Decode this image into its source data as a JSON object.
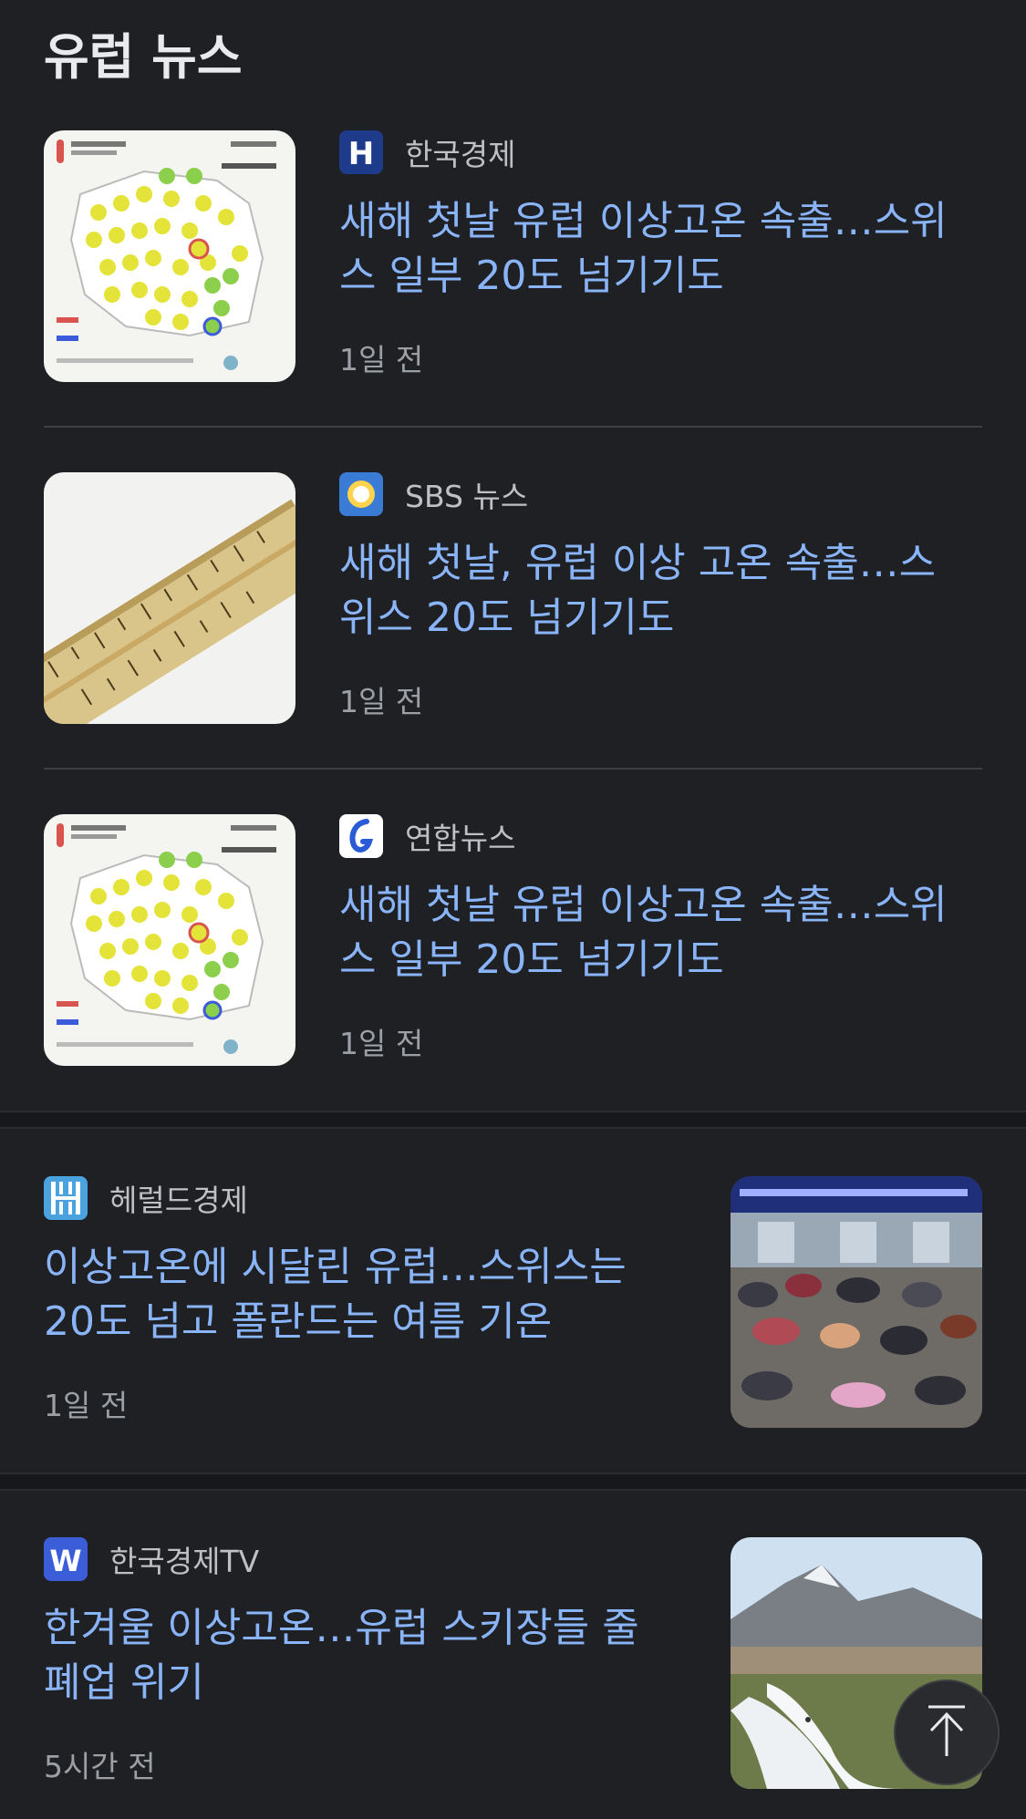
{
  "section": {
    "title": "유럽 뉴스"
  },
  "stories": [
    {
      "source": "한국경제",
      "headline_l1": "새해 첫날 유럽 이상고온 속출…스위",
      "headline_l2": "스 일부 20도 넘기기도",
      "time": "1일 전",
      "icon": "hankyung-logo-icon",
      "thumb": "poland-temperature-map-image"
    },
    {
      "source": "SBS 뉴스",
      "headline_l1": "새해 첫날, 유럽 이상 고온 속출…스",
      "headline_l2": "위스 20도 넘기기도",
      "time": "1일 전",
      "icon": "sbs-logo-icon",
      "thumb": "thermometer-image"
    },
    {
      "source": "연합뉴스",
      "headline_l1": "새해 첫날 유럽 이상고온 속출…스위",
      "headline_l2": "스 일부 20도 넘기기도",
      "time": "1일 전",
      "icon": "yonhap-logo-icon",
      "thumb": "poland-temperature-map-image"
    },
    {
      "source": "헤럴드경제",
      "headline_l1": "이상고온에 시달린 유럽…스위스는",
      "headline_l2": "20도 넘고 폴란드는 여름 기온",
      "time": "1일 전",
      "icon": "herald-logo-icon",
      "thumb": "crowd-outdoor-image"
    },
    {
      "source": "한국경제TV",
      "headline_l1": "한겨울 이상고온…유럽 스키장들 줄",
      "headline_l2": "폐업 위기",
      "time": "5시간 전",
      "icon": "wowtv-logo-icon",
      "thumb": "ski-slope-image"
    }
  ],
  "scroll_top_button": {
    "icon": "arrow-up-to-top-icon"
  },
  "colors": {
    "background": "#1f2024",
    "headline": "#8ab4f8",
    "source": "#bdc1c6",
    "time": "#9aa0a6"
  }
}
